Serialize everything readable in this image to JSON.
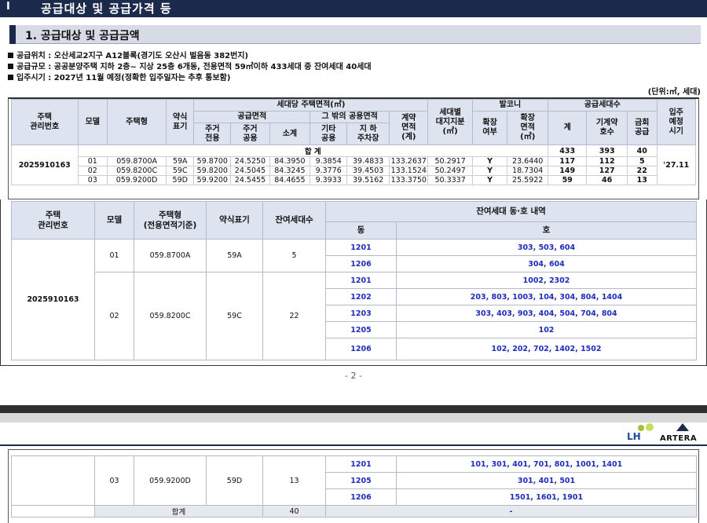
{
  "section": {
    "number": "Ⅰ",
    "title": "공급대상 및 공급가격 등"
  },
  "subsection": {
    "title": "1. 공급대상 및 공급금액"
  },
  "info": [
    "공급위치 : 오산세교2지구 A12블록(경기도 오산시 벌음동 382번지)",
    "공급규모 : 공공분양주택 지하 2층~ 지상 25층 6개동, 전용면적 59㎡이하 433세대 중 잔여세대 40세대",
    "입주시기 : 2027년 11월 예정(정확한 입주일자는 추후 통보함)"
  ],
  "unit": "(단위:㎡, 세대)",
  "table1": {
    "headers": {
      "house_no": "주택\n관리번호",
      "model": "모델",
      "type": "주택형",
      "abbr": "약식\n표기",
      "area_group": "세대당 주택면적(㎡)",
      "supply_area": "공급면적",
      "private": "주거\n전용",
      "common": "주거\n공용",
      "subtotal": "소계",
      "other_common": "그 밖의 공용면적",
      "other": "기타\n공용",
      "parking": "지  하\n주차장",
      "contract": "계약\n면적\n(계)",
      "land": "세대별\n대지지분\n(㎡)",
      "balcony": "발코니",
      "ext": "확장\n여부",
      "ext_area": "확장\n면적\n(㎡)",
      "units_group": "공급세대수",
      "sum": "계",
      "prior": "기계약\n호수",
      "recovered": "금회\n공급",
      "move_in": "입주\n예정\n시기"
    },
    "total": {
      "label": "합 계",
      "sum": "433",
      "prior": "393",
      "recovered": "40"
    },
    "house_no": "2025910163",
    "move_in": "'27.11",
    "rows": [
      {
        "model": "01",
        "type": "059.8700A",
        "abbr": "59A",
        "private": "59.8700",
        "common": "24.5250",
        "subtotal": "84.3950",
        "other": "9.3854",
        "parking": "39.4833",
        "contract": "133.2637",
        "land": "50.2917",
        "ext": "Y",
        "ext_area": "23.6440",
        "sum": "117",
        "prior": "112",
        "recovered": "5"
      },
      {
        "model": "02",
        "type": "059.8200C",
        "abbr": "59C",
        "private": "59.8200",
        "common": "24.5045",
        "subtotal": "84.3245",
        "other": "9.3776",
        "parking": "39.4503",
        "contract": "133.1524",
        "land": "50.2497",
        "ext": "Y",
        "ext_area": "18.7304",
        "sum": "149",
        "prior": "127",
        "recovered": "22"
      },
      {
        "model": "03",
        "type": "059.9200D",
        "abbr": "59D",
        "private": "59.9200",
        "common": "24.5455",
        "subtotal": "84.4655",
        "other": "9.3933",
        "parking": "39.5162",
        "contract": "133.3750",
        "land": "50.3337",
        "ext": "Y",
        "ext_area": "25.5922",
        "sum": "59",
        "prior": "46",
        "recovered": "13"
      }
    ]
  },
  "table2": {
    "headers": {
      "house_no": "주택\n관리번호",
      "model": "모델",
      "type": "주택형\n(전용면적기준)",
      "abbr": "약식표기",
      "remain": "잔여세대수",
      "detail": "잔여세대 동·호 내역",
      "dong": "동",
      "ho": "호"
    },
    "house_no": "2025910163",
    "groups": [
      {
        "model": "01",
        "type": "059.8700A",
        "abbr": "59A",
        "remain": "5",
        "rows": [
          {
            "dong": "1201",
            "ho": "303, 503, 604"
          },
          {
            "dong": "1206",
            "ho": "304, 604"
          }
        ]
      },
      {
        "model": "02",
        "type": "059.8200C",
        "abbr": "59C",
        "remain": "22",
        "rows": [
          {
            "dong": "1201",
            "ho": "1002, 2302"
          },
          {
            "dong": "1202",
            "ho": "203, 803, 1003, 104, 304, 804, 1404"
          },
          {
            "dong": "1203",
            "ho": "303, 403, 903, 404, 504, 704, 804"
          },
          {
            "dong": "1205",
            "ho": "102"
          },
          {
            "dong": "1206",
            "ho": "102, 202, 702, 1402, 1502"
          }
        ]
      }
    ]
  },
  "page_number": "- 2 -",
  "logos": {
    "lh": "LH",
    "artera": "ARTERA"
  },
  "table3": {
    "group": {
      "model": "03",
      "type": "059.9200D",
      "abbr": "59D",
      "remain": "13",
      "rows": [
        {
          "dong": "1201",
          "ho": "101, 301, 401, 701, 801, 1001, 1401"
        },
        {
          "dong": "1205",
          "ho": "301, 401, 501"
        },
        {
          "dong": "1206",
          "ho": "1501, 1601, 1901"
        }
      ]
    },
    "sum": {
      "label": "합계",
      "remain": "40",
      "ho": "-"
    }
  }
}
